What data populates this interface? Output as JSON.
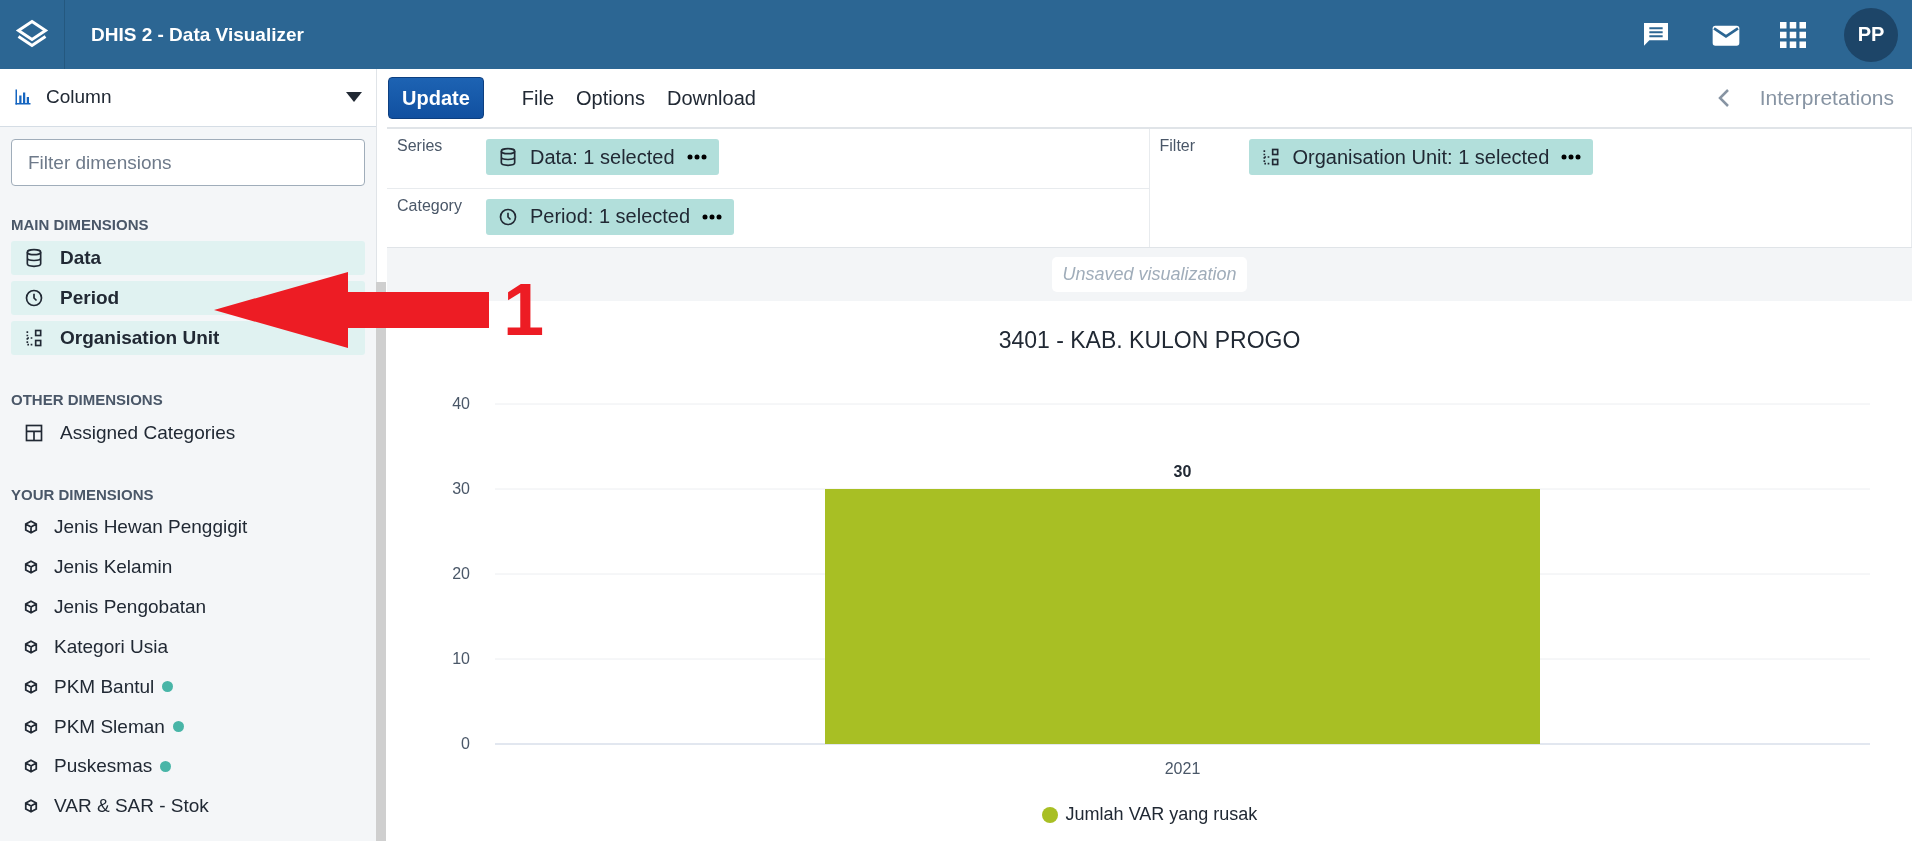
{
  "header": {
    "title": "DHIS 2 - Data Visualizer",
    "avatar": "PP"
  },
  "type_selector": {
    "label": "Column"
  },
  "toolbar": {
    "buttons": [
      {
        "label": "Update",
        "kind": "primary"
      },
      {
        "label": "File",
        "kind": "menu"
      },
      {
        "label": "Options",
        "kind": "menu"
      },
      {
        "label": "Download",
        "kind": "menu"
      }
    ],
    "interpretations": {
      "label": "Interpretations",
      "disabled": true
    }
  },
  "sidebar": {
    "filter": {
      "placeholder": "Filter dimensions"
    },
    "sections": [
      {
        "title": "MAIN DIMENSIONS",
        "items": [
          {
            "label": "Data",
            "kind": "data",
            "in_layout": true,
            "dot": false
          },
          {
            "label": "Period",
            "kind": "period",
            "in_layout": true,
            "dot": false
          },
          {
            "label": "Organisation Unit",
            "kind": "orgunit",
            "in_layout": true,
            "dot": false
          }
        ]
      },
      {
        "title": "OTHER DIMENSIONS",
        "items": [
          {
            "label": "Assigned Categories",
            "kind": "table",
            "in_layout": false,
            "dot": false
          }
        ]
      },
      {
        "title": "YOUR DIMENSIONS",
        "items": [
          {
            "label": "Jenis Hewan Penggigit",
            "kind": "cube",
            "in_layout": false,
            "dot": false
          },
          {
            "label": "Jenis Kelamin",
            "kind": "cube",
            "in_layout": false,
            "dot": false
          },
          {
            "label": "Jenis Pengobatan",
            "kind": "cube",
            "in_layout": false,
            "dot": false
          },
          {
            "label": "Kategori Usia",
            "kind": "cube",
            "in_layout": false,
            "dot": false
          },
          {
            "label": "PKM Bantul",
            "kind": "cube",
            "in_layout": false,
            "dot": true
          },
          {
            "label": "PKM Sleman",
            "kind": "cube",
            "in_layout": false,
            "dot": true
          },
          {
            "label": "Puskesmas",
            "kind": "cube",
            "in_layout": false,
            "dot": true
          },
          {
            "label": "VAR & SAR - Stok",
            "kind": "cube",
            "in_layout": false,
            "dot": false
          }
        ]
      }
    ]
  },
  "layout": {
    "left": [
      {
        "label": "Series",
        "chips": [
          {
            "label": "Data: 1 selected",
            "kind": "data"
          }
        ]
      },
      {
        "label": "Category",
        "chips": [
          {
            "label": "Period: 1 selected",
            "kind": "period"
          }
        ]
      }
    ],
    "right": [
      {
        "label": "Filter",
        "chips": [
          {
            "label": "Organisation Unit: 1 selected",
            "kind": "orgunit"
          }
        ]
      }
    ]
  },
  "status": "Unsaved visualization",
  "chart": {
    "chart_data": {
      "type": "bar",
      "title": "3401 - KAB. KULON PROGO",
      "categories": [
        "2021"
      ],
      "series": [
        {
          "name": "Jumlah VAR yang rusak",
          "color": "#a8bf24",
          "values": [
            30
          ]
        }
      ],
      "ylim": [
        0,
        40
      ],
      "grid": true,
      "yticks": [
        0,
        10,
        20,
        30,
        40
      ],
      "data_labels": true
    }
  },
  "annotation": {
    "label": "1"
  }
}
